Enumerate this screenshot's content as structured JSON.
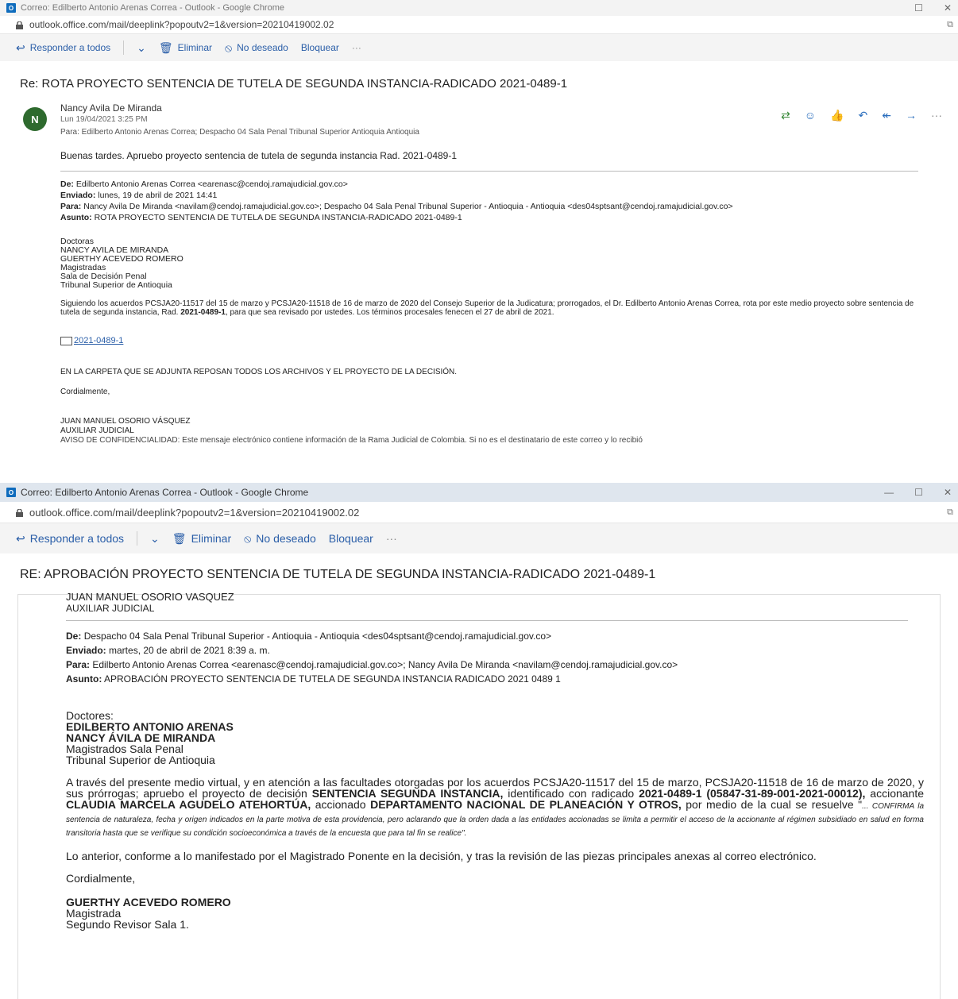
{
  "win1": {
    "title": "Correo: Edilberto Antonio Arenas Correa - Outlook - Google Chrome",
    "url": "outlook.office.com/mail/deeplink?popoutv2=1&version=20210419002.02",
    "toolbar": {
      "reply_all": "Responder a todos",
      "delete": "Eliminar",
      "not_wanted": "No deseado",
      "block": "Bloquear",
      "more": "···"
    },
    "subject": "Re: ROTA PROYECTO SENTENCIA DE TUTELA DE SEGUNDA INSTANCIA-RADICADO 2021-0489-1",
    "sender": {
      "initial": "N",
      "name": "Nancy Avila De Miranda",
      "date": "Lun 19/04/2021 3:25 PM",
      "to": "Para:  Edilberto Antonio Arenas Correa;  Despacho 04 Sala Penal Tribunal Superior  Antioquia  Antioquia"
    },
    "greeting": "Buenas tardes. Apruebo proyecto sentencia de tutela de segunda instancia Rad. 2021-0489-1",
    "header": {
      "de_label": "De:",
      "de": "Edilberto Antonio Arenas Correa <earenasc@cendoj.ramajudicial.gov.co>",
      "enviado_label": "Enviado:",
      "enviado": "lunes, 19 de abril de 2021 14:41",
      "para_label": "Para:",
      "para": "Nancy Avila De Miranda <navilam@cendoj.ramajudicial.gov.co>; Despacho 04 Sala Penal Tribunal Superior - Antioquia - Antioquia <des04sptsant@cendoj.ramajudicial.gov.co>",
      "asunto_label": "Asunto:",
      "asunto": "ROTA PROYECTO SENTENCIA DE TUTELA DE SEGUNDA INSTANCIA-RADICADO 2021-0489-1"
    },
    "addressees": [
      "Doctoras",
      "NANCY AVILA DE MIRANDA",
      "GUERTHY ACEVEDO ROMERO",
      "Magistradas",
      "Sala de Decisión Penal",
      "Tribunal Superior de Antioquia"
    ],
    "paragraph_a": "Siguiendo los acuerdos PCSJA20-11517 del 15 de marzo y PCSJA20-11518 de 16 de marzo de 2020 del Consejo Superior de la Judicatura; prorrogados, el Dr. Edilberto Antonio Arenas Correa, rota por este medio proyecto sobre sentencia de tutela de segunda instancia, Rad. ",
    "paragraph_bold": "2021-0489-1",
    "paragraph_b": ", para que sea revisado por ustedes. Los términos procesales fenecen el 27 de abril de 2021.",
    "folder_link": "2021-0489-1",
    "folder_note": "EN LA CARPETA QUE SE ADJUNTA REPOSAN TODOS LOS ARCHIVOS Y EL PROYECTO DE LA DECISIÓN.",
    "closing": "Cordialmente,",
    "signature": [
      "JUAN MANUEL OSORIO VÁSQUEZ",
      "AUXILIAR JUDICIAL"
    ],
    "cutoff": "AVISO DE CONFIDENCIALIDAD: Este mensaje electrónico contiene información de la Rama Judicial de Colombia. Si no es el destinatario de este correo y lo recibió"
  },
  "win2": {
    "title": "Correo: Edilberto Antonio Arenas Correa - Outlook - Google Chrome",
    "url": "outlook.office.com/mail/deeplink?popoutv2=1&version=20210419002.02",
    "toolbar": {
      "reply_all": "Responder a todos",
      "delete": "Eliminar",
      "not_wanted": "No deseado",
      "block": "Bloquear",
      "more": "···"
    },
    "subject": "RE: APROBACIÓN PROYECTO SENTENCIA DE TUTELA DE SEGUNDA INSTANCIA-RADICADO 2021-0489-1",
    "top_sig": [
      "JUAN MANUEL OSORIO VASQUEZ",
      "AUXILIAR JUDICIAL"
    ],
    "header": {
      "de_label": "De:",
      "de": "Despacho 04 Sala Penal Tribunal Superior - Antioquia - Antioquia <des04sptsant@cendoj.ramajudicial.gov.co>",
      "enviado_label": "Enviado:",
      "enviado": "martes, 20 de abril de 2021 8:39 a. m.",
      "para_label": "Para:",
      "para": "Edilberto Antonio Arenas Correa <earenasc@cendoj.ramajudicial.gov.co>; Nancy Avila De Miranda <navilam@cendoj.ramajudicial.gov.co>",
      "asunto_label": "Asunto:",
      "asunto": "APROBACIÓN PROYECTO SENTENCIA DE TUTELA DE SEGUNDA INSTANCIA RADICADO 2021 0489 1"
    },
    "addressee_title": "Doctores:",
    "addressee_names": [
      "EDILBERTO ANTONIO ARENAS",
      "NANCY ÁVILA DE MIRANDA"
    ],
    "addressee_rest": [
      "Magistrados Sala Penal",
      "Tribunal Superior de Antioquia"
    ],
    "p1": {
      "t1": "A través del presente medio virtual, y en atención a las facultades otorgadas por los acuerdos PCSJA20-11517 del 15 de marzo, PCSJA20-11518 de 16 de marzo de 2020, y sus prórrogas; apruebo el proyecto de decisión ",
      "b1": "SENTENCIA SEGUNDA INSTANCIA,",
      "t2": " identificado con radicado ",
      "b2": "2021-0489-1 (05847-31-89-001-2021-00012),",
      "t3": " accionante ",
      "b3": "CLAUDIA MARCELA AGUDELO ATEHORTÚA,",
      "t4": " accionado ",
      "b4": "DEPARTAMENTO NACIONAL DE PLANEACIÓN Y OTROS,",
      "t5": " por medio de la cual se resuelve \"",
      "i1": "... CONFIRMA la sentencia de naturaleza, fecha y origen indicados en la parte motiva de esta providencia, pero aclarando que la orden dada a las entidades accionadas se limita a permitir el acceso de la accionante al régimen subsidiado en salud en forma transitoria hasta que se verifique su condición socioeconómica a través de la encuesta que para tal fin se realice\"."
    },
    "p2": "Lo anterior, conforme a lo manifestado por el Magistrado Ponente en la decisión, y tras la revisión de las piezas principales anexas al correo electrónico.",
    "closing": "Cordialmente,",
    "signature_name": "GUERTHY ACEVEDO ROMERO",
    "signature_rest": [
      "Magistrada",
      "Segundo Revisor Sala 1."
    ]
  }
}
